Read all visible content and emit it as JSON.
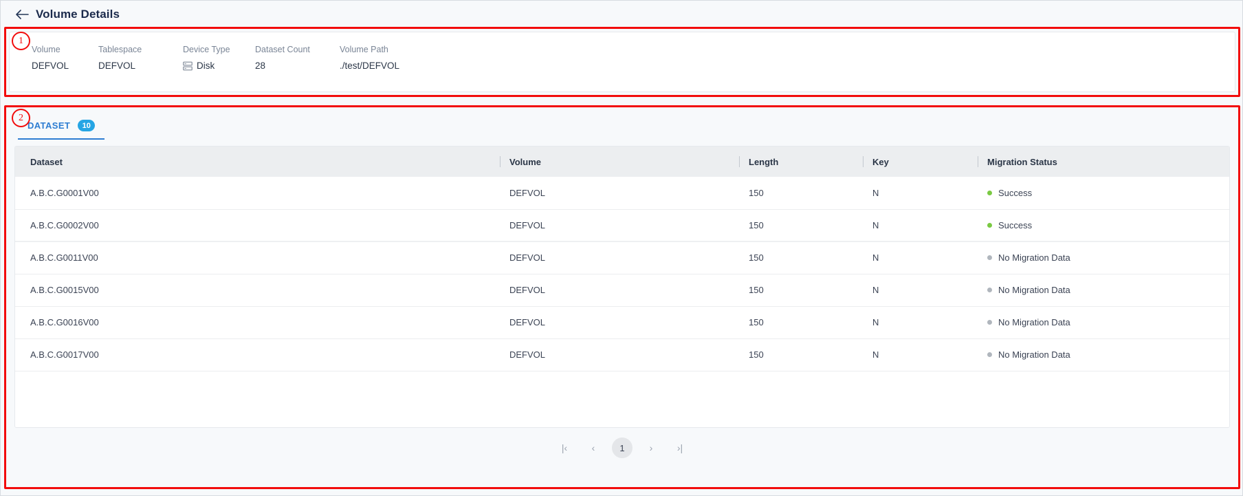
{
  "header": {
    "back_icon": "arrow-left-icon",
    "title": "Volume Details"
  },
  "summary": {
    "fields": [
      {
        "label": "Volume",
        "value": "DEFVOL"
      },
      {
        "label": "Tablespace",
        "value": "DEFVOL"
      },
      {
        "label": "Device Type",
        "value": "Disk",
        "icon": "disk-icon"
      },
      {
        "label": "Dataset Count",
        "value": "28"
      },
      {
        "label": "Volume Path",
        "value": "./test/DEFVOL"
      }
    ]
  },
  "dataset": {
    "tab": {
      "label": "DATASET",
      "badge": "10"
    },
    "columns": [
      "Dataset",
      "Volume",
      "Length",
      "Key",
      "Migration Status"
    ],
    "rows": [
      {
        "dataset": "A.B.C.G0001V00",
        "volume": "DEFVOL",
        "length": "150",
        "key": "N",
        "status": "Success",
        "status_color": "#7ac943"
      },
      {
        "dataset": "A.B.C.G0002V00",
        "volume": "DEFVOL",
        "length": "150",
        "key": "N",
        "status": "Success",
        "status_color": "#7ac943"
      },
      {
        "dataset": "A.B.C.G0011V00",
        "volume": "DEFVOL",
        "length": "150",
        "key": "N",
        "status": "No Migration Data",
        "status_color": "#b0b6bd"
      },
      {
        "dataset": "A.B.C.G0015V00",
        "volume": "DEFVOL",
        "length": "150",
        "key": "N",
        "status": "No Migration Data",
        "status_color": "#b0b6bd"
      },
      {
        "dataset": "A.B.C.G0016V00",
        "volume": "DEFVOL",
        "length": "150",
        "key": "N",
        "status": "No Migration Data",
        "status_color": "#b0b6bd"
      },
      {
        "dataset": "A.B.C.G0017V00",
        "volume": "DEFVOL",
        "length": "150",
        "key": "N",
        "status": "No Migration Data",
        "status_color": "#b0b6bd"
      }
    ]
  },
  "pagination": {
    "first_label": "|‹",
    "prev_label": "‹",
    "current_page": "1",
    "next_label": "›",
    "last_label": "›|"
  },
  "annotations": [
    {
      "number": "1"
    },
    {
      "number": "2"
    }
  ],
  "colors": {
    "accent_blue": "#2d7dd2",
    "badge_blue": "#25a5e4",
    "annotation_red": "#f20c0c",
    "success_green": "#7ac943",
    "neutral_gray": "#b0b6bd"
  }
}
